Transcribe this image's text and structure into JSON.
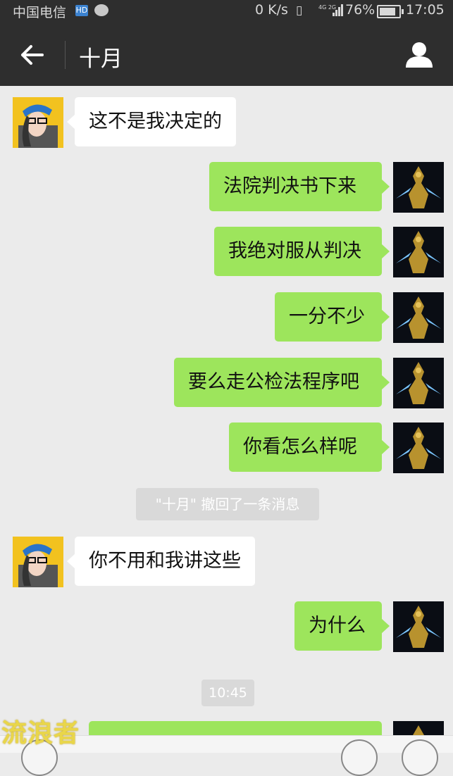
{
  "status_bar": {
    "carrier": "中国电信",
    "hd_badge": "HD",
    "net_speed": "0 K/s",
    "network": "4G 2G",
    "battery": "76%",
    "time": "17:05"
  },
  "header": {
    "title": "十月"
  },
  "messages": [
    {
      "side": "left",
      "text": "这不是我决定的"
    },
    {
      "side": "right",
      "text": "法院判决书下来"
    },
    {
      "side": "right",
      "text": "我绝对服从判决"
    },
    {
      "side": "right",
      "text": "一分不少"
    },
    {
      "side": "right",
      "text": "要么走公检法程序吧"
    },
    {
      "side": "right",
      "text": "你看怎么样呢"
    },
    {
      "side": "system",
      "text": "\"十月\" 撤回了一条消息"
    },
    {
      "side": "left",
      "text": "你不用和我讲这些"
    },
    {
      "side": "right",
      "text": "为什么"
    },
    {
      "side": "time",
      "text": "10:45"
    }
  ],
  "watermark": "流浪者",
  "colors": {
    "header_bg": "#2e2e2e",
    "chat_bg": "#ebebeb",
    "sent_bubble": "#9de55c",
    "received_bubble": "#ffffff"
  }
}
